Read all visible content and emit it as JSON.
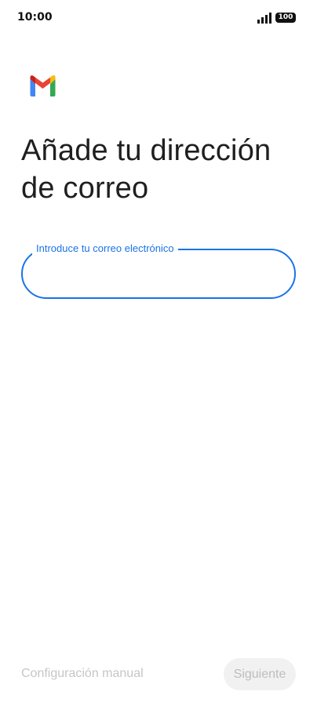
{
  "status_bar": {
    "time": "10:00",
    "signal_icon": "signal-bars-icon",
    "battery_level": "100"
  },
  "logo": {
    "icon": "gmail-logo-icon",
    "colors": {
      "blue": "#4285F4",
      "red": "#EA4335",
      "yellow": "#FBBC04",
      "green": "#34A853",
      "dark_red": "#C5221F"
    }
  },
  "page": {
    "title": "Añade tu dirección de correo"
  },
  "email_field": {
    "label": "Introduce tu correo electrónico",
    "value": "",
    "accent_color": "#1a73e8"
  },
  "actions": {
    "manual_setup_label": "Configuración manual",
    "next_label": "Siguiente"
  }
}
